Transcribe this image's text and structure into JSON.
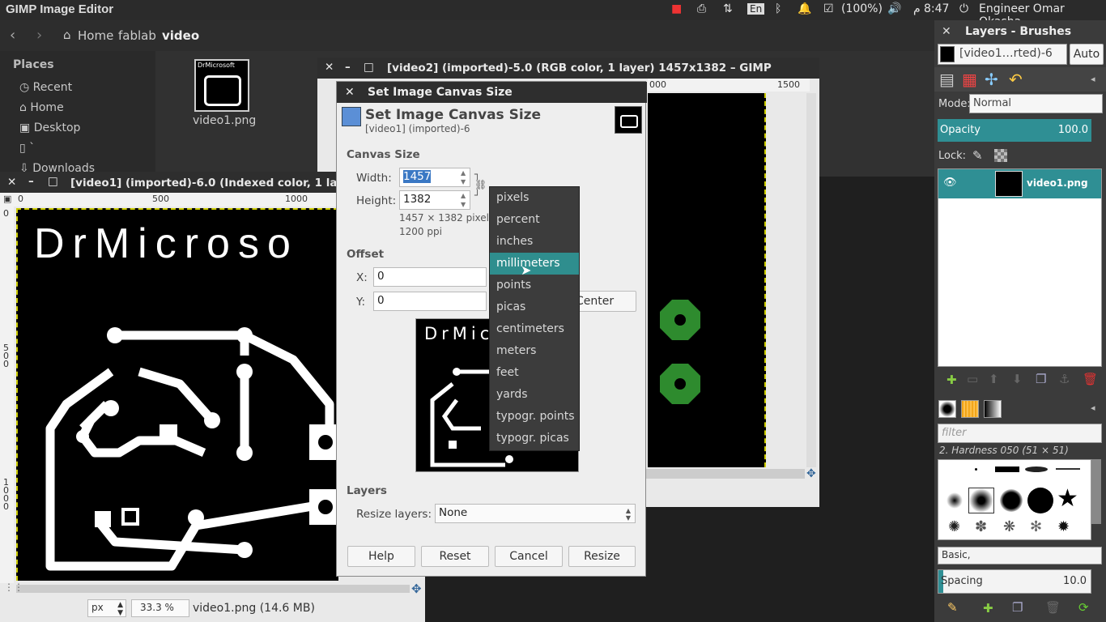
{
  "topbar": {
    "app_title": "GIMP Image Editor",
    "lang": "En",
    "battery": "(100%)",
    "arabic": "م",
    "time": "8:47",
    "user": "Engineer Omar Okasha"
  },
  "files": {
    "breadcrumb": [
      "Home",
      "fablab",
      "video"
    ],
    "places_heading": "Places",
    "places": [
      "Recent",
      "Home",
      "Desktop",
      "`",
      "Downloads"
    ],
    "file_name": "video1.png"
  },
  "video2_window": {
    "title": "[video2] (imported)-5.0 (RGB color, 1 layer) 1457x1382 – GIMP",
    "rulers": [
      "000",
      "1500"
    ]
  },
  "video1_window": {
    "title": "[video1] (imported)-6.0 (Indexed color, 1 layer)",
    "rulers": [
      "0",
      "500",
      "1000"
    ],
    "vrulers": [
      "0",
      "5\n0\n0",
      "1\n0\n0\n0"
    ],
    "canvas_text": "DrMicroso",
    "unit": "px",
    "zoom": "33.3 %",
    "status": "video1.png (14.6 MB)"
  },
  "dialog": {
    "window_title": "Set Image Canvas Size",
    "heading": "Set Image Canvas Size",
    "subheading": "[video1] (imported)-6",
    "canvas_section": "Canvas Size",
    "width_label": "Width:",
    "width_value": "1457",
    "height_label": "Height:",
    "height_value": "1382",
    "size_info": "1457 × 1382 pixels",
    "ppi_info": "1200 ppi",
    "offset_section": "Offset",
    "x_label": "X:",
    "x_value": "0",
    "y_label": "Y:",
    "y_value": "0",
    "center_label": "Center",
    "preview_text": "DrMic",
    "layers_section": "Layers",
    "resize_layers_label": "Resize layers:",
    "resize_layers_value": "None",
    "buttons": [
      "Help",
      "Reset",
      "Cancel",
      "Resize"
    ],
    "logo_text": "DrMicrosoft"
  },
  "units_menu": {
    "items": [
      "pixels",
      "percent",
      "inches",
      "millimeters",
      "points",
      "picas",
      "centimeters",
      "meters",
      "feet",
      "yards",
      "typogr. points",
      "typogr. picas"
    ],
    "selected": "millimeters"
  },
  "dock": {
    "title": "Layers - Brushes",
    "image_select": "[video1…rted)-6",
    "auto": "Auto",
    "mode_label": "Mode:",
    "mode_value": "Normal",
    "opacity_label": "Opacity",
    "opacity_value": "100.0",
    "lock_label": "Lock:",
    "layer_name": "video1.png",
    "filter_placeholder": "filter",
    "brush_name": "2. Hardness 050 (51 × 51)",
    "brush_set": "Basic,",
    "spacing_label": "Spacing",
    "spacing_value": "10.0"
  },
  "colors": {
    "teal": "#2f8f94",
    "green_pad": "#2e8b2e",
    "dark": "#2e2e2e"
  }
}
